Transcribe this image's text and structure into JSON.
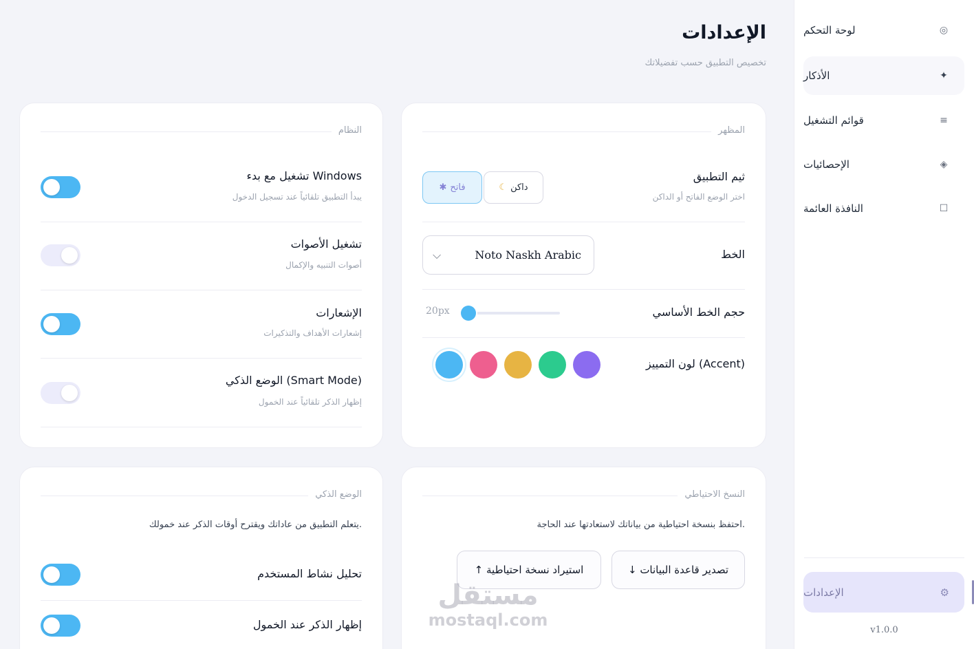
{
  "sidebar": {
    "items": [
      {
        "label": "لوحة التحكم",
        "icon": "target-icon",
        "glyph": "◎"
      },
      {
        "label": "الأذكار",
        "icon": "sparkle-icon",
        "glyph": "✦"
      },
      {
        "label": "قوائم التشغيل",
        "icon": "list-icon",
        "glyph": "≡"
      },
      {
        "label": "الإحصائيات",
        "icon": "diamond-icon",
        "glyph": "◈"
      },
      {
        "label": "النافذة العائمة",
        "icon": "window-icon",
        "glyph": "☐"
      }
    ],
    "settings": {
      "label": "الإعدادات",
      "icon": "gear-icon",
      "glyph": "⚙"
    },
    "version": "v1.0.0"
  },
  "header": {
    "title": "الإعدادات",
    "subtitle": "تخصيص التطبيق حسب تفضيلاتك"
  },
  "appearance": {
    "title": "المظهر",
    "theme": {
      "label": "ثيم التطبيق",
      "desc": "اختر الوضع الفاتح أو الداكن",
      "light": {
        "label": "فاتح",
        "glyph": "✱"
      },
      "dark": {
        "label": "داكن",
        "glyph": "☾"
      },
      "selected": "light"
    },
    "font": {
      "label": "الخط",
      "value": "Noto Naskh Arabic"
    },
    "font_size": {
      "label": "حجم الخط الأساسي",
      "value": "20px",
      "fraction": 0.0
    },
    "accent": {
      "label": "لون التمييز (Accent)",
      "colors": [
        "#8b6cf0",
        "#2ccb8e",
        "#e7b443",
        "#ee5f8f",
        "#4cb7f3"
      ],
      "selected_index": 4
    }
  },
  "system": {
    "title": "النظام",
    "rows": [
      {
        "label": "تشغيل مع بدء Windows",
        "desc": "يبدأ التطبيق تلقائياً عند تسجيل الدخول",
        "on": true
      },
      {
        "label": "تشغيل الأصوات",
        "desc": "أصوات التنبيه والإكمال",
        "on": false
      },
      {
        "label": "الإشعارات",
        "desc": "إشعارات الأهداف والتذكيرات",
        "on": true
      },
      {
        "label": "الوضع الذكي (Smart Mode)",
        "desc": "إظهار الذكر تلقائياً عند الخمول",
        "on": false
      }
    ]
  },
  "backup": {
    "title": "النسخ الاحتياطي",
    "desc": "احتفظ بنسخة احتياطية من بياناتك لاستعادتها عند الحاجة.",
    "export_label": "↓ تصدير قاعدة البيانات",
    "import_label": "↑ استيراد نسخة احتياطية"
  },
  "smart": {
    "title": "الوضع الذكي",
    "desc": "يتعلم التطبيق من عاداتك ويقترح أوقات الذكر عند خمولك.",
    "rows": [
      {
        "label": "تحليل نشاط المستخدم",
        "on": true
      },
      {
        "label": "إظهار الذكر عند الخمول",
        "on": true
      }
    ]
  },
  "watermark": {
    "line1": "مستقل",
    "line2": "mostaql.com"
  }
}
